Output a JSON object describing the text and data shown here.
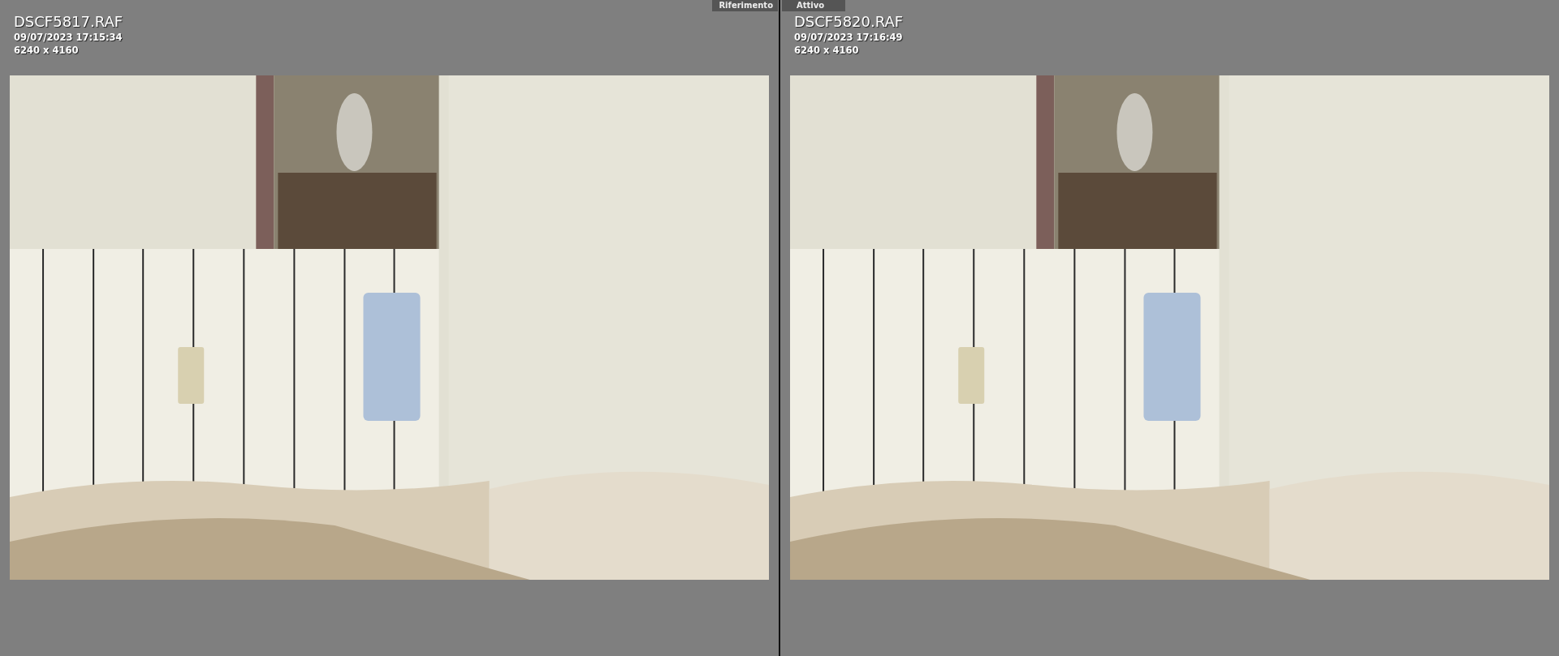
{
  "panes": [
    {
      "tab": "Riferimento",
      "filename": "DSCF5817.RAF",
      "date": "09/07/2023 17:15:34",
      "dimensions": "6240 x 4160"
    },
    {
      "tab": "Attivo",
      "filename": "DSCF5820.RAF",
      "date": "09/07/2023 17:16:49",
      "dimensions": "6240 x 4160"
    }
  ]
}
